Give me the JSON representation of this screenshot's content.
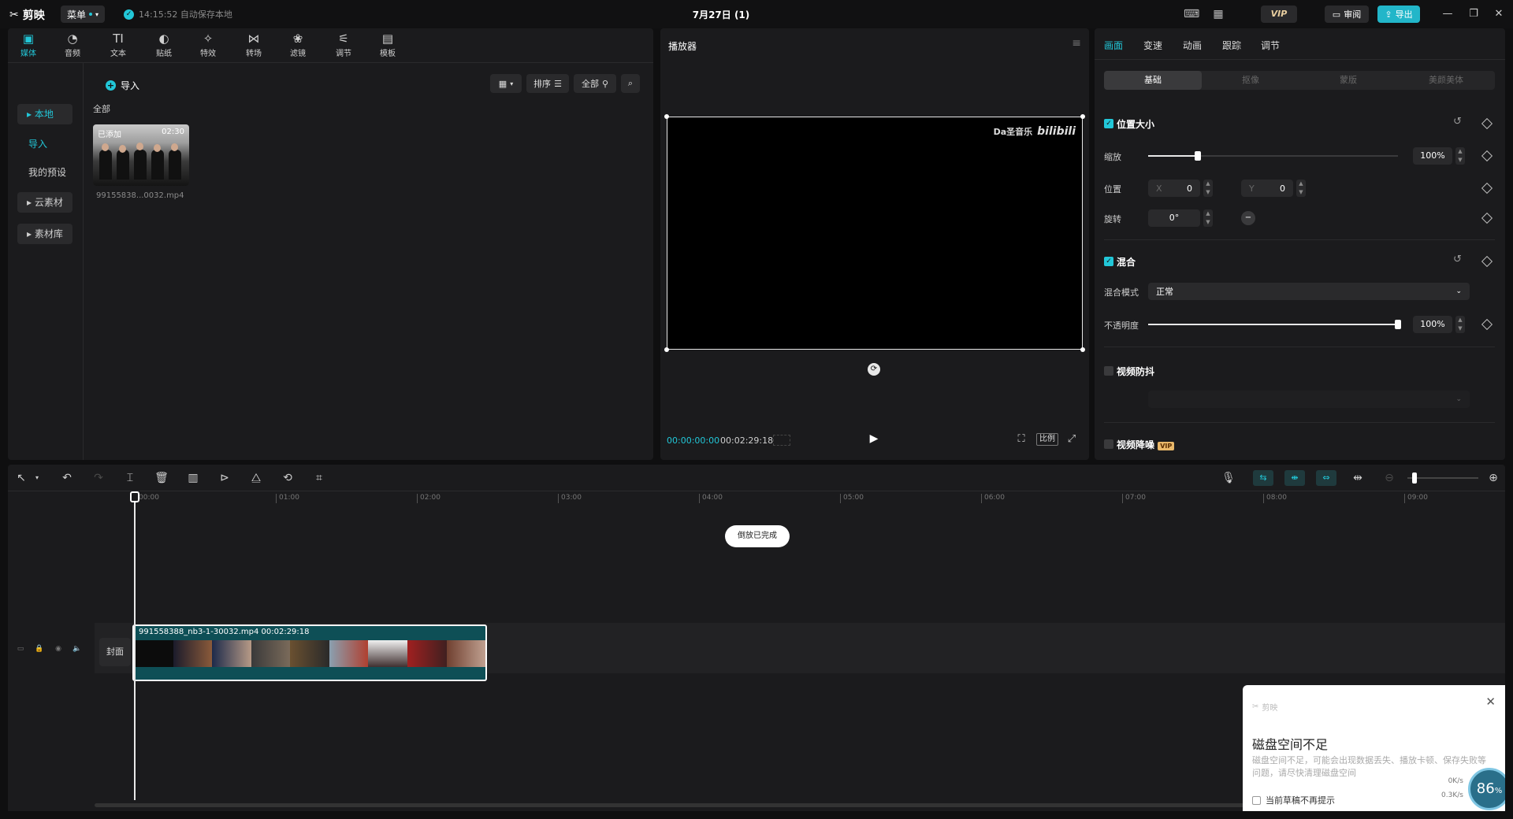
{
  "app": {
    "logo_text": "剪映",
    "menu_label": "菜单",
    "autosave_text": "14:15:52 自动保存本地",
    "doc_title": "7月27日 (1)",
    "vip_label": "VIP",
    "review_label": "审阅",
    "export_label": "导出"
  },
  "tool_tabs": [
    {
      "icon": "▣",
      "label": "媒体"
    },
    {
      "icon": "◔",
      "label": "音频"
    },
    {
      "icon": "TI",
      "label": "文本"
    },
    {
      "icon": "◐",
      "label": "贴纸"
    },
    {
      "icon": "✧",
      "label": "特效"
    },
    {
      "icon": "⋈",
      "label": "转场"
    },
    {
      "icon": "❀",
      "label": "滤镜"
    },
    {
      "icon": "⚟",
      "label": "调节"
    },
    {
      "icon": "▤",
      "label": "模板"
    }
  ],
  "media_side": {
    "local": "本地",
    "import": "导入",
    "my_presets": "我的预设",
    "cloud": "云素材",
    "library": "素材库"
  },
  "media": {
    "import_label": "导入",
    "sort_label": "排序",
    "all_filter_label": "全部",
    "all_label": "全部",
    "clip": {
      "badge": "已添加",
      "duration": "02:30",
      "name": "99155838...0032.mp4"
    }
  },
  "player": {
    "title": "播放器",
    "watermark_text": "Da圣音乐",
    "watermark_logo": "bilibili",
    "current_time": "00:00:00:00",
    "total_time": "00:02:29:18",
    "ratio_label": "比例"
  },
  "props": {
    "tabs": [
      "画面",
      "变速",
      "动画",
      "跟踪",
      "调节"
    ],
    "subtabs": [
      "基础",
      "抠像",
      "蒙版",
      "美颜美体"
    ],
    "position_size": "位置大小",
    "scale_label": "缩放",
    "scale_value": "100%",
    "scale_level": 0.2,
    "position_label": "位置",
    "x_label": "X",
    "x_value": "0",
    "y_label": "Y",
    "y_value": "0",
    "rotate_label": "旋转",
    "rotate_value": "0°",
    "blend_title": "混合",
    "blend_mode_label": "混合模式",
    "blend_mode_value": "正常",
    "opacity_label": "不透明度",
    "opacity_value": "100%",
    "opacity_level": 1.0,
    "stabilize": "视频防抖",
    "denoise": "视频降噪",
    "vip_tag": "VIP"
  },
  "timeline": {
    "ruler": [
      "00:00",
      "01:00",
      "02:00",
      "03:00",
      "04:00",
      "05:00",
      "06:00",
      "07:00",
      "08:00",
      "09:00"
    ],
    "toast": "倒放已完成",
    "cover_label": "封面",
    "clip_label": "991558388_nb3-1-30032.mp4  00:02:29:18"
  },
  "disk_warning": {
    "brand": "剪映",
    "title": "磁盘空间不足",
    "body": "磁盘空间不足，可能会出现数据丢失、播放卡顿、保存失败等问题，请尽快清理磁盘空间",
    "checkbox": "当前草稿不再提示",
    "speed_up": "0K/s",
    "speed_down": "0.3K/s",
    "gauge": "86"
  },
  "colors": {
    "accent": "#22c7d8",
    "panel": "#1b1b1d",
    "clip": "#0e4f56"
  }
}
